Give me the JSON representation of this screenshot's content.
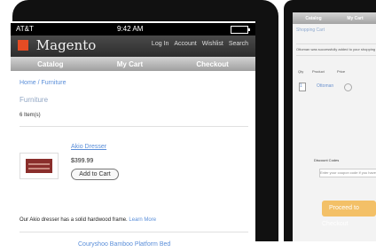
{
  "left_phone": {
    "status": {
      "carrier": "AT&T",
      "time": "9:42 AM"
    },
    "header": {
      "logo": "Magento",
      "links": [
        "Log In",
        "Account",
        "Wishlist",
        "Search"
      ]
    },
    "tabs": [
      "Catalog",
      "My Cart",
      "Checkout"
    ],
    "breadcrumb": "Home / Furniture",
    "title": "Furniture",
    "item_count": "6 Item(s)",
    "product": {
      "name": "Akio Dresser",
      "price": "$399.99",
      "button": "Add to Cart",
      "description": "Our Akio dresser has a solid hardwood frame.",
      "learn_more": "Learn More"
    },
    "next_product": "Couryshoo Bamboo Platform Bed"
  },
  "right_phone": {
    "tabs": [
      "Catalog",
      "My Cart"
    ],
    "title": "Shopping Cart",
    "message": "Ottoman was successfully added to your shopping cart.",
    "table": {
      "headers": [
        "Qty",
        "Product",
        "Price"
      ],
      "row": {
        "qty": "1",
        "product": "Ottoman"
      }
    },
    "discount_label": "Discount Codes",
    "coupon_placeholder": "Enter your coupon code if you have one.",
    "checkout_button": "Proceed to Checkout"
  },
  "colors": {
    "accent": "#e64c24",
    "link": "#5a8ed9",
    "checkout": "#f3c067"
  }
}
